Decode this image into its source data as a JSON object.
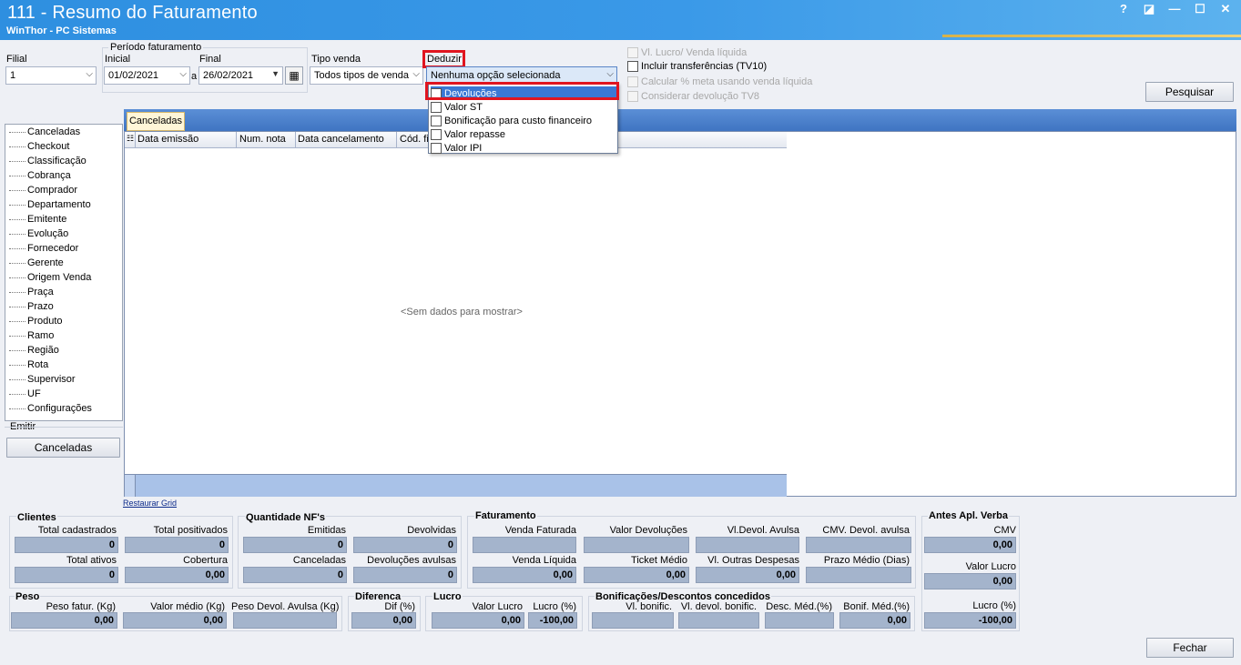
{
  "window": {
    "title": "111 - Resumo do Faturamento",
    "subtitle": "WinThor - PC Sistemas",
    "help": "?",
    "restore": "◪",
    "minimize": "—",
    "maximize": "☐",
    "close": "✕"
  },
  "filters": {
    "filial_label": "Filial",
    "filial_value": "1",
    "periodo_label": "Período faturamento",
    "inicial_label": "Inicial",
    "inicial_value": "01/02/2021",
    "a_label": "a",
    "final_label": "Final",
    "final_value": "26/02/2021",
    "tipo_venda_label": "Tipo venda",
    "tipo_venda_value": "Todos tipos de venda",
    "deduzir_label": "Deduzir",
    "deduzir_value": "Nenhuma opção selecionada",
    "deduzir_options": [
      "Devoluções",
      "Valor ST",
      "Bonificação para custo financeiro",
      "Valor repasse",
      "Valor IPI"
    ]
  },
  "options": {
    "vl_lucro": "Vl. Lucro/ Venda líquida",
    "incluir_transf": "Incluir transferências  (TV10)",
    "calcular_meta": "Calcular % meta usando venda líquida",
    "considerar_dev": "Considerar devolução TV8"
  },
  "buttons": {
    "pesquisar": "Pesquisar",
    "emitir_label": "Emitir",
    "canceladas": "Canceladas",
    "fechar": "Fechar",
    "restaurar_grid": "Restaurar Grid"
  },
  "nav": {
    "items": [
      "Canceladas",
      "Checkout",
      "Classificação",
      "Cobrança",
      "Comprador",
      "Departamento",
      "Emitente",
      "Evolução",
      "Fornecedor",
      "Gerente",
      "Origem Venda",
      "Praça",
      "Prazo",
      "Produto",
      "Ramo",
      "Região",
      "Rota",
      "Supervisor",
      "UF",
      "Configurações"
    ]
  },
  "grid": {
    "tab": "Canceladas",
    "columns": [
      "Data emissão",
      "Num. nota",
      "Data cancelamento",
      "Cód. fi"
    ],
    "empty": "<Sem dados para mostrar>"
  },
  "summary": {
    "clientes": {
      "title": "Clientes",
      "total_cadastrados": {
        "label": "Total cadastrados",
        "value": "0"
      },
      "total_positivados": {
        "label": "Total positivados",
        "value": "0"
      },
      "total_ativos": {
        "label": "Total ativos",
        "value": "0"
      },
      "cobertura": {
        "label": "Cobertura",
        "value": "0,00"
      }
    },
    "quantidade": {
      "title": "Quantidade NF's",
      "emitidas": {
        "label": "Emitidas",
        "value": "0"
      },
      "devolvidas": {
        "label": "Devolvidas",
        "value": "0"
      },
      "canceladas": {
        "label": "Canceladas",
        "value": "0"
      },
      "devolucoes_avulsas": {
        "label": "Devoluções avulsas",
        "value": "0"
      }
    },
    "faturamento": {
      "title": "Faturamento",
      "venda_faturada": {
        "label": "Venda Faturada",
        "value": ""
      },
      "valor_devolucoes": {
        "label": "Valor Devoluções",
        "value": ""
      },
      "vl_devol_avulsa": {
        "label": "Vl.Devol. Avulsa",
        "value": ""
      },
      "cmv_devol_avulsa": {
        "label": "CMV. Devol. avulsa",
        "value": ""
      },
      "venda_liquida": {
        "label": "Venda Líquida",
        "value": "0,00"
      },
      "ticket_medio": {
        "label": "Ticket Médio",
        "value": "0,00"
      },
      "vl_outras_despesas": {
        "label": "Vl. Outras Despesas",
        "value": "0,00"
      },
      "prazo_medio": {
        "label": "Prazo Médio (Dias)",
        "value": ""
      }
    },
    "antes_apl": {
      "title": "Antes Apl. Verba",
      "cmv": {
        "label": "CMV",
        "value": "0,00"
      },
      "valor_lucro": {
        "label": "Valor Lucro",
        "value": "0,00"
      },
      "lucro_pct": {
        "label": "Lucro (%)",
        "value": "-100,00"
      }
    },
    "peso": {
      "title": "Peso",
      "peso_fatur": {
        "label": "Peso fatur. (Kg)",
        "value": "0,00"
      },
      "valor_medio": {
        "label": "Valor médio (Kg)",
        "value": "0,00"
      },
      "peso_devol": {
        "label": "Peso Devol. Avulsa (Kg)",
        "value": ""
      }
    },
    "diferenca": {
      "title": "Diferenca",
      "dif": {
        "label": "Dif (%)",
        "value": "0,00"
      }
    },
    "lucro": {
      "title": "Lucro",
      "valor_lucro": {
        "label": "Valor Lucro",
        "value": "0,00"
      },
      "lucro_pct": {
        "label": "Lucro (%)",
        "value": "-100,00"
      }
    },
    "bonif": {
      "title": "Bonificações/Descontos concedidos",
      "vl_bonific": {
        "label": "Vl. bonific.",
        "value": ""
      },
      "vl_devol_bonific": {
        "label": "Vl. devol. bonific.",
        "value": ""
      },
      "desc_med": {
        "label": "Desc. Méd.(%)",
        "value": ""
      },
      "bonif_med": {
        "label": "Bonif. Méd.(%)",
        "value": "0,00"
      }
    }
  }
}
